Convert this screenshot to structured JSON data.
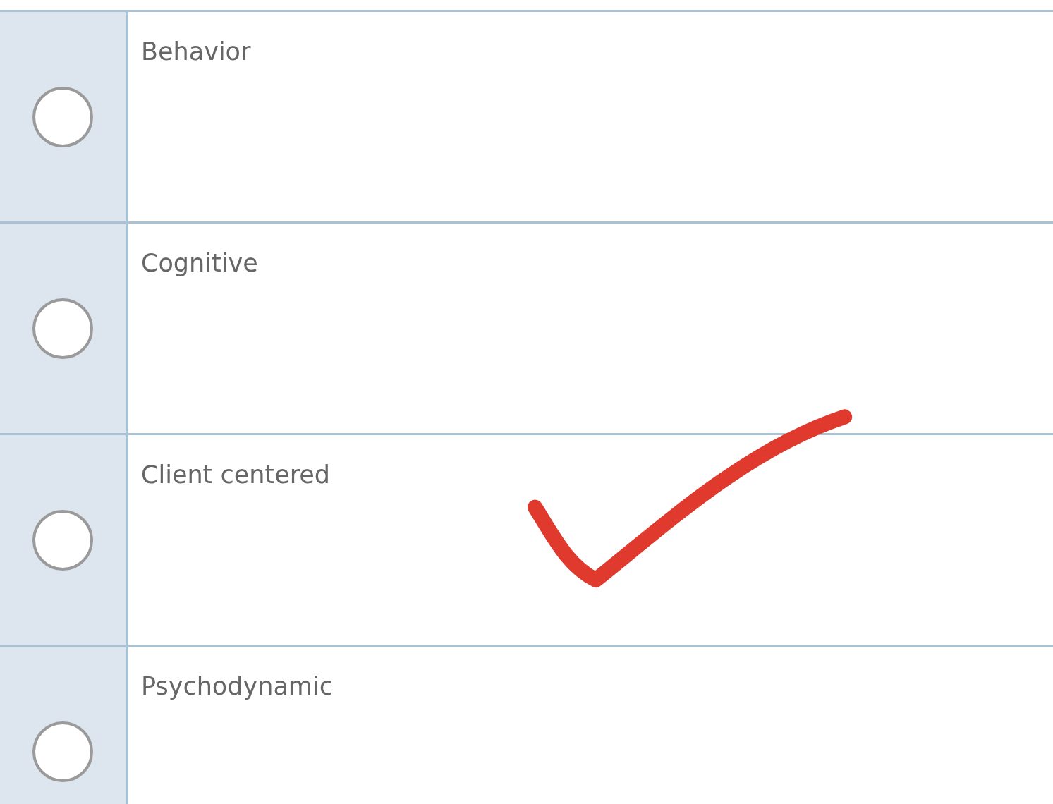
{
  "options": [
    {
      "label": "Behavior",
      "selected": false,
      "marked": false
    },
    {
      "label": "Cognitive",
      "selected": false,
      "marked": false
    },
    {
      "label": "Client centered",
      "selected": false,
      "marked": true
    },
    {
      "label": "Psychodynamic",
      "selected": false,
      "marked": false
    }
  ]
}
